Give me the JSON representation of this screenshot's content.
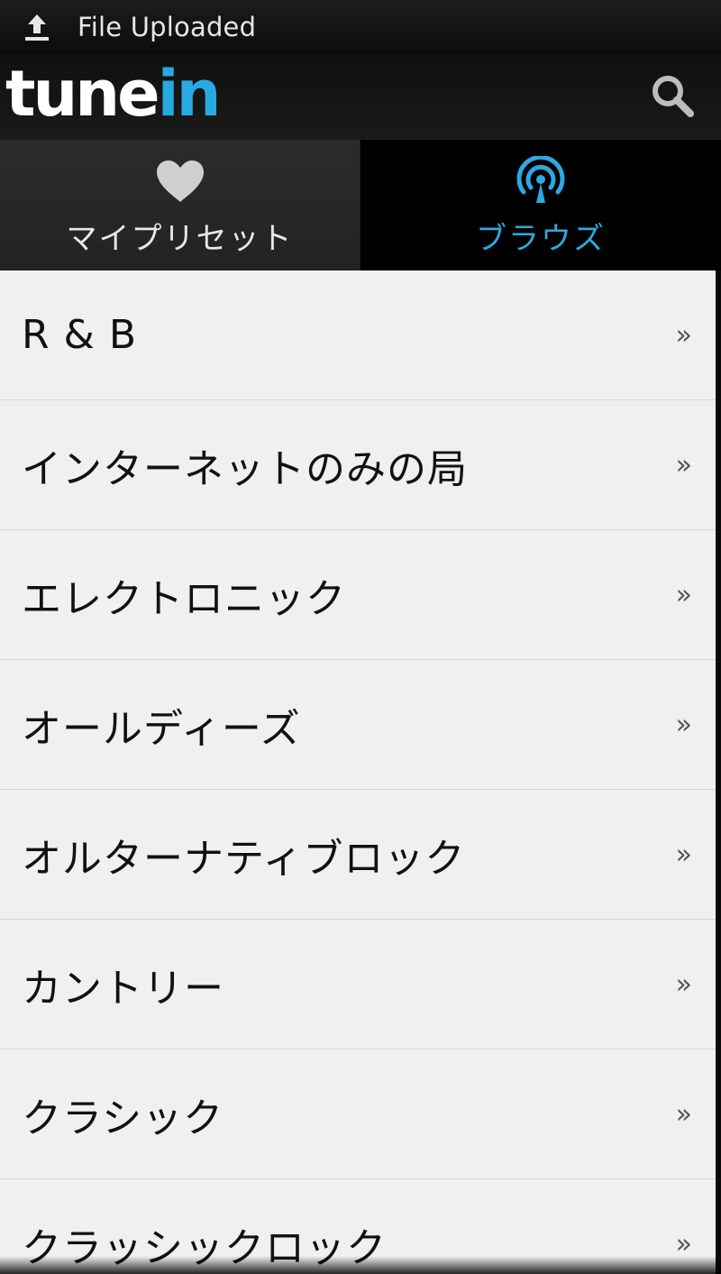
{
  "status_bar": {
    "notification_text": "File Uploaded",
    "icon": "upload-icon"
  },
  "app_bar": {
    "logo_part1": "tune",
    "logo_part2": "in",
    "search_icon": "search-icon",
    "colors": {
      "logo_accent": "#29a9e1"
    }
  },
  "tabs": [
    {
      "label": "マイプリセット",
      "icon": "heart-icon",
      "selected": false
    },
    {
      "label": "ブラウズ",
      "icon": "broadcast-icon",
      "selected": true
    }
  ],
  "list": {
    "chevron": "»",
    "items": [
      {
        "label": "R & B"
      },
      {
        "label": "インターネットのみの局"
      },
      {
        "label": "エレクトロニック"
      },
      {
        "label": "オールディーズ"
      },
      {
        "label": "オルターナティブロック"
      },
      {
        "label": "カントリー"
      },
      {
        "label": "クラシック"
      },
      {
        "label": "クラッシックロック"
      }
    ]
  },
  "colors": {
    "accent": "#2fa7e0",
    "list_background": "#eef0ee",
    "bar_background": "#111111"
  }
}
